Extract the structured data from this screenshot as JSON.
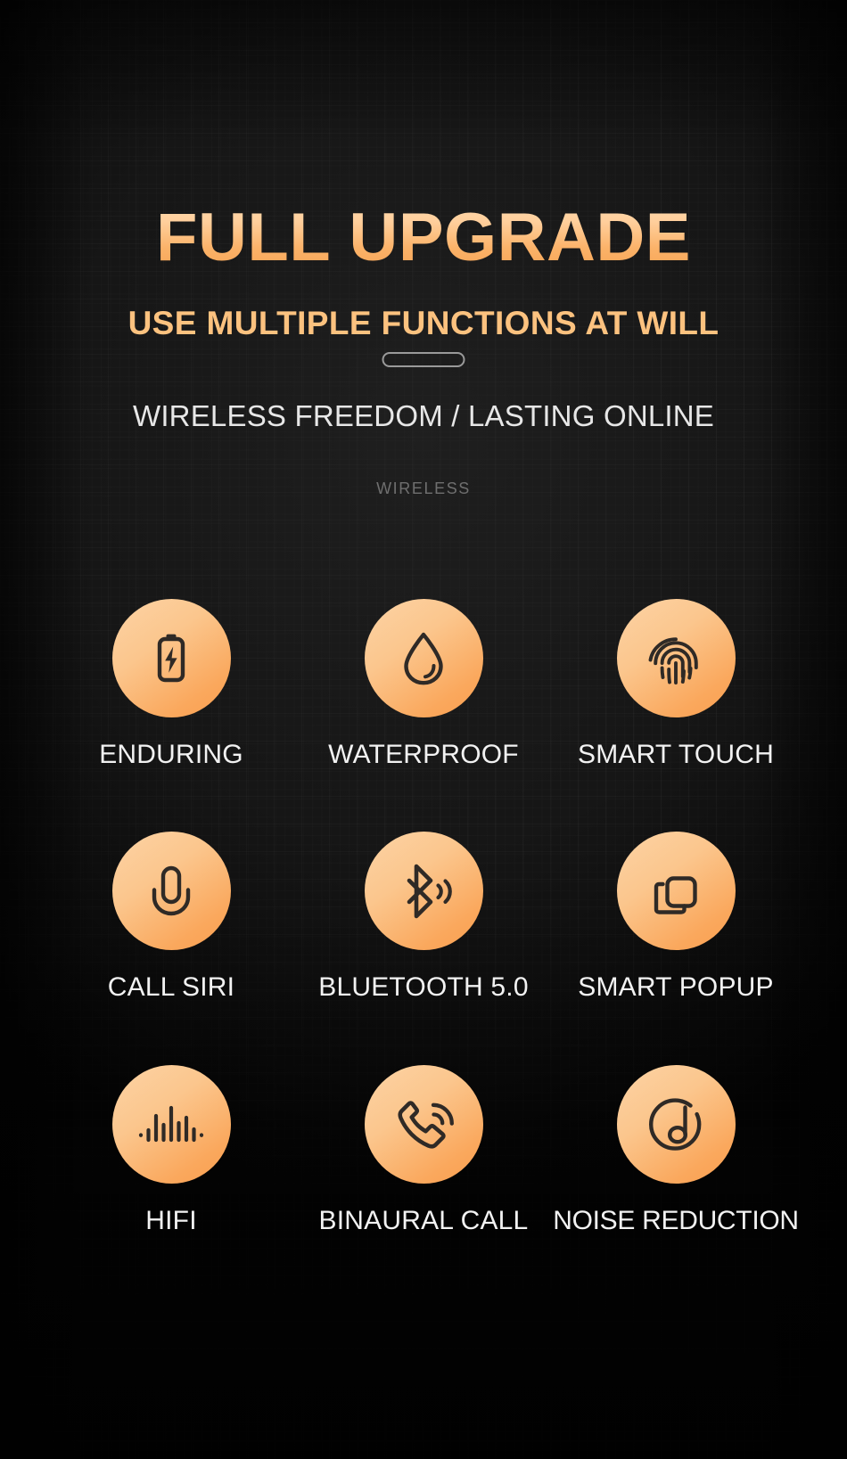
{
  "header": {
    "title": "FULL UPGRADE",
    "subtitle": "USE MULTIPLE FUNCTIONS AT WILL",
    "tagline": "WIRELESS FREEDOM / LASTING ONLINE",
    "eyebrow": "WIRELESS"
  },
  "colors": {
    "background": "#161616",
    "title_gradient_top": "#ffd8ab",
    "title_gradient_bottom": "#f7a455",
    "subtitle": "#fcc27f",
    "tagline": "#e7e7e7",
    "eyebrow": "#6f6f6f",
    "icon_circle_light": "#fcd3a5",
    "icon_circle_dark": "#f99e4f",
    "icon_stroke": "#2f2a26",
    "label": "#f2f2f2",
    "divider_stroke": "#9a9a9a"
  },
  "features": [
    [
      {
        "label": "ENDURING",
        "icon": "battery-charging-icon"
      },
      {
        "label": "WATERPROOF",
        "icon": "water-drop-icon"
      },
      {
        "label": "SMART TOUCH",
        "icon": "fingerprint-icon"
      }
    ],
    [
      {
        "label": "CALL SIRI",
        "icon": "microphone-icon"
      },
      {
        "label": "BLUETOOTH 5.0",
        "icon": "bluetooth-signal-icon"
      },
      {
        "label": "SMART POPUP",
        "icon": "two-squares-popup-icon"
      }
    ],
    [
      {
        "label": "HIFI",
        "icon": "audio-waveform-icon"
      },
      {
        "label": "BINAURAL CALL",
        "icon": "phone-call-waves-icon"
      },
      {
        "label": "NOISE REDUCTION",
        "icon": "music-note-circle-icon"
      }
    ]
  ]
}
